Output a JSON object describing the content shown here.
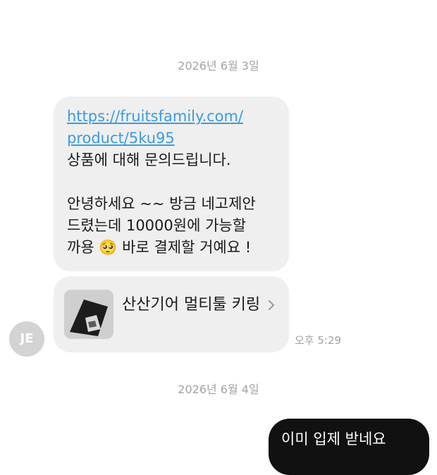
{
  "date_separators": [
    "2026년 6월 3일",
    "2026년 6월 4일"
  ],
  "incoming_message": {
    "link_line1": "https://fruitsfamily.com/",
    "link_line2": "product/5ku95",
    "lines": [
      "상품에 대해 문의드립니다.",
      "",
      "안녕하세요 ~~ 방금 네고제안",
      "드렸는데 10000원에 가능할",
      "까용 🥺 바로 결제할 거예요 !"
    ]
  },
  "product_card": {
    "name": "산산기어 멀티툴 키링",
    "icon": "chevron-right-icon"
  },
  "avatar": {
    "initials": "JE"
  },
  "timestamp": "오후 5:29",
  "outgoing_message": {
    "text": "이미 입제 받네요"
  }
}
